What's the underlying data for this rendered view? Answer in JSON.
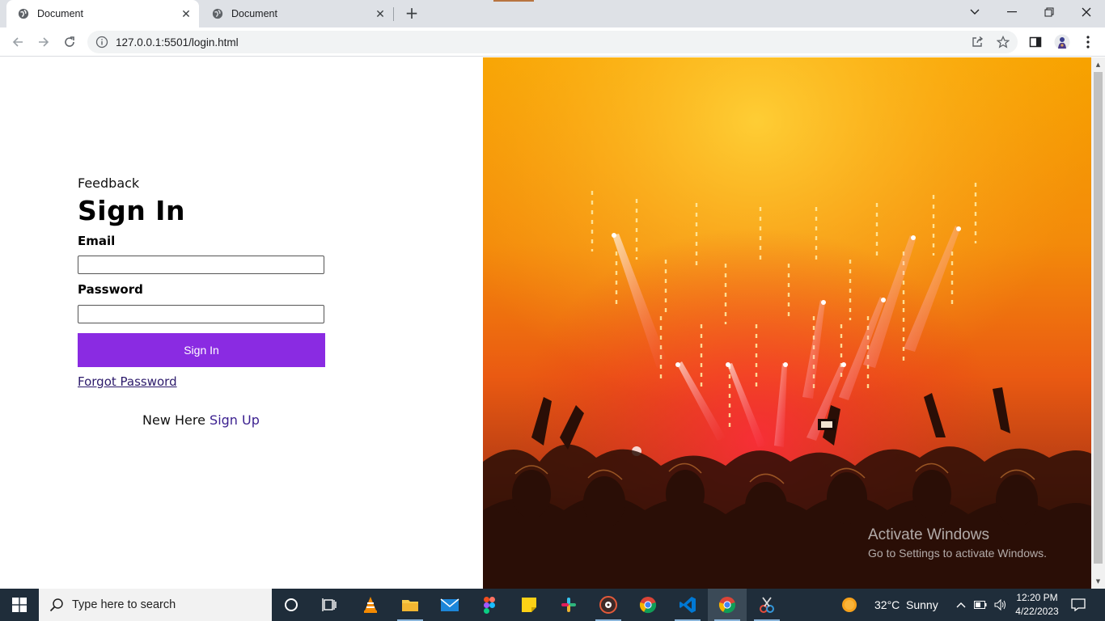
{
  "browser": {
    "tabs": [
      {
        "title": "Document",
        "active": true
      },
      {
        "title": "Document",
        "active": false
      }
    ],
    "url": "127.0.0.1:5501/login.html"
  },
  "page": {
    "feedback_label": "Feedback",
    "title": "Sign In",
    "email_label": "Email",
    "email_value": "",
    "password_label": "Password",
    "password_value": "",
    "signin_button": "Sign In",
    "forgot_link": "Forgot Password",
    "new_here_text": "New Here",
    "signup_link": "Sign Up",
    "accent_color": "#8a2be2"
  },
  "watermark": {
    "line1": "Activate Windows",
    "line2": "Go to Settings to activate Windows."
  },
  "taskbar": {
    "search_placeholder": "Type here to search",
    "pinned_icons": [
      "cortana-icon",
      "task-view-icon",
      "vlc-icon",
      "file-explorer-icon",
      "mail-icon",
      "figma-icon",
      "sticky-notes-icon",
      "slack-icon",
      "media-player-icon",
      "chrome-icon",
      "vscode-icon",
      "chrome-active-icon",
      "snipping-tool-icon"
    ],
    "weather_temp": "32°C",
    "weather_desc": "Sunny",
    "time": "12:20 PM",
    "date": "4/22/2023"
  }
}
